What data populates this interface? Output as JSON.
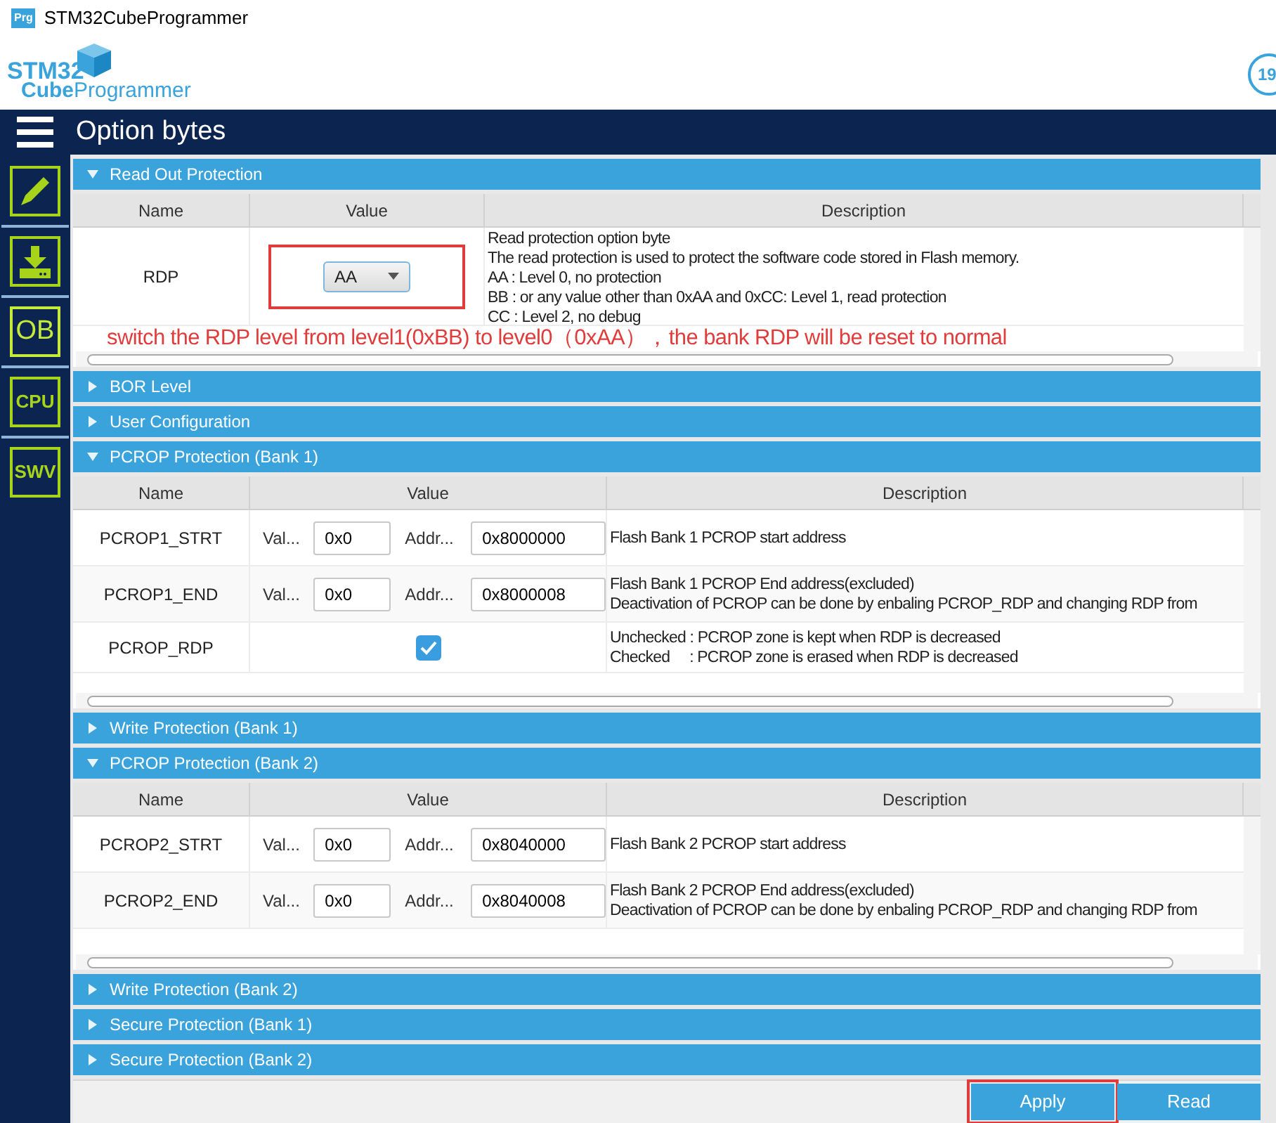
{
  "window": {
    "title": "STM32CubeProgrammer",
    "app_icon": "Prg"
  },
  "logo": {
    "line1": "STM32",
    "line2a": "Cube",
    "line2b": "Programmer",
    "badge": "19"
  },
  "header": {
    "title": "Option bytes"
  },
  "sidebar": {
    "items": [
      {
        "kind": "icon",
        "selected": false
      },
      {
        "kind": "icon",
        "selected": false
      },
      {
        "kind": "text",
        "label": "OB",
        "selected": true
      },
      {
        "kind": "text",
        "label": "CPU",
        "selected": false
      },
      {
        "kind": "text",
        "label": "SWV",
        "selected": false
      }
    ]
  },
  "sections": [
    {
      "title": "Read Out Protection",
      "expanded": true,
      "columns": [
        "Name",
        "Value",
        "Description"
      ],
      "rows": [
        {
          "name": "RDP",
          "kind": "combo",
          "value": "AA",
          "highlighted": true,
          "description": [
            "Read protection option byte",
            "The read protection is used to protect the software code stored in Flash memory.",
            "AA : Level 0, no protection",
            "BB : or any value other than 0xAA and 0xCC: Level 1, read protection",
            "CC : Level 2, no debug"
          ]
        }
      ],
      "annotation": "switch the RDP level from level1(0xBB) to level0（0xAA），the bank RDP will be reset to normal"
    },
    {
      "title": "BOR Level",
      "expanded": false
    },
    {
      "title": "User Configuration",
      "expanded": false
    },
    {
      "title": "PCROP Protection (Bank 1)",
      "expanded": true,
      "columns": [
        "Name",
        "Value",
        "Description"
      ],
      "rows": [
        {
          "name": "PCROP1_STRT",
          "kind": "address",
          "value_label": "Val...",
          "value": "0x0",
          "address_label": "Addr...",
          "address": "0x8000000",
          "description": [
            "Flash Bank 1 PCROP start address"
          ]
        },
        {
          "name": "PCROP1_END",
          "kind": "address",
          "value_label": "Val...",
          "value": "0x0",
          "address_label": "Addr...",
          "address": "0x8000008",
          "description": [
            "Flash Bank 1 PCROP End address(excluded)",
            "Deactivation of PCROP can be done by enbaling PCROP_RDP and changing RDP from"
          ]
        },
        {
          "name": "PCROP_RDP",
          "kind": "checkbox",
          "checked": true,
          "description": [
            "Unchecked : PCROP zone is kept when RDP is decreased",
            "Checked     : PCROP zone is erased when RDP is decreased"
          ]
        }
      ]
    },
    {
      "title": "Write Protection (Bank 1)",
      "expanded": false
    },
    {
      "title": "PCROP Protection (Bank 2)",
      "expanded": true,
      "columns": [
        "Name",
        "Value",
        "Description"
      ],
      "rows": [
        {
          "name": "PCROP2_STRT",
          "kind": "address",
          "value_label": "Val...",
          "value": "0x0",
          "address_label": "Addr...",
          "address": "0x8040000",
          "description": [
            "Flash Bank 2 PCROP start address"
          ]
        },
        {
          "name": "PCROP2_END",
          "kind": "address",
          "value_label": "Val...",
          "value": "0x0",
          "address_label": "Addr...",
          "address": "0x8040008",
          "description": [
            "Flash Bank 2 PCROP End address(excluded)",
            "Deactivation of PCROP can be done by enbaling PCROP_RDP and changing RDP from"
          ]
        }
      ]
    },
    {
      "title": "Write Protection (Bank 2)",
      "expanded": false
    },
    {
      "title": "Secure Protection (Bank 1)",
      "expanded": false
    },
    {
      "title": "Secure Protection (Bank 2)",
      "expanded": false
    }
  ],
  "buttons": [
    {
      "label": "Apply",
      "highlighted": true
    },
    {
      "label": "Read",
      "highlighted": false
    }
  ]
}
